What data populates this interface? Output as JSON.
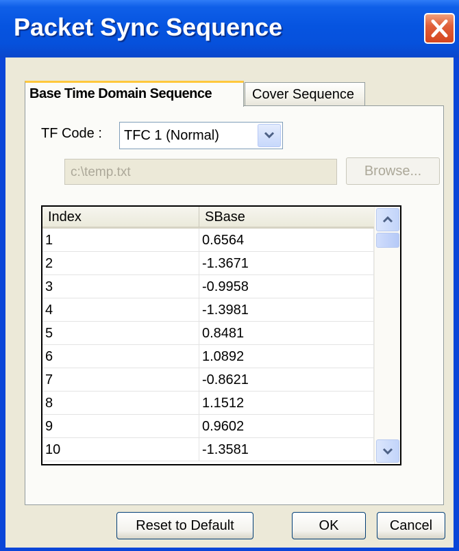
{
  "window": {
    "title": "Packet Sync Sequence",
    "close_icon": "close-icon"
  },
  "tabs": [
    {
      "label": "Base Time Domain Sequence",
      "active": true
    },
    {
      "label": "Cover Sequence",
      "active": false
    }
  ],
  "tf_code": {
    "label": "TF Code :",
    "selected": "TFC 1 (Normal)"
  },
  "file": {
    "path": "c:\\temp.txt",
    "browse_label": "Browse..."
  },
  "table": {
    "columns": [
      "Index",
      "SBase"
    ],
    "rows": [
      [
        "1",
        "0.6564"
      ],
      [
        "2",
        "-1.3671"
      ],
      [
        "3",
        "-0.9958"
      ],
      [
        "4",
        "-1.3981"
      ],
      [
        "5",
        "0.8481"
      ],
      [
        "6",
        "1.0892"
      ],
      [
        "7",
        "-0.8621"
      ],
      [
        "8",
        "1.1512"
      ],
      [
        "9",
        "0.9602"
      ],
      [
        "10",
        "-1.3581"
      ]
    ]
  },
  "buttons": {
    "reset": "Reset to Default",
    "ok": "OK",
    "cancel": "Cancel"
  },
  "colors": {
    "titlebar": "#0654e0",
    "tab_highlight": "#ffc83c",
    "close_button": "#e0603a"
  }
}
